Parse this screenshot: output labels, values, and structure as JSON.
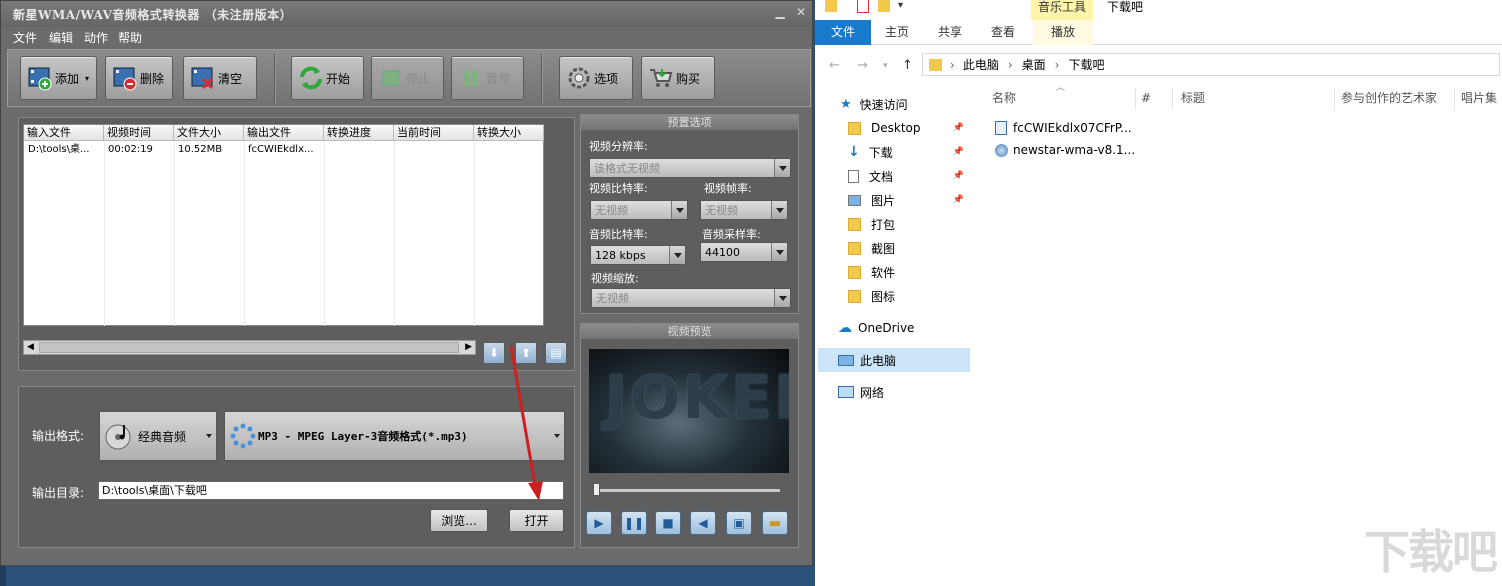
{
  "app": {
    "title": "新星WMA/WAV音频格式转换器 （未注册版本）",
    "menu": [
      "文件",
      "编辑",
      "动作",
      "帮助"
    ],
    "toolbar": {
      "add": "添加",
      "delete": "删除",
      "clear": "清空",
      "start": "开始",
      "stop": "停止",
      "pause": "暂停",
      "options": "选项",
      "buy": "购买"
    },
    "table": {
      "headers": [
        "输入文件",
        "视频时间",
        "文件大小",
        "输出文件",
        "转换进度",
        "当前时间",
        "转换大小"
      ],
      "rows": [
        [
          "D:\\tools\\桌...",
          "00:02:19",
          "10.52MB",
          "fcCWIEkdlx...",
          "",
          "",
          ""
        ]
      ]
    },
    "output": {
      "format_label": "输出格式:",
      "category": "经典音频",
      "format": "MP3 - MPEG Layer-3音频格式(*.mp3)",
      "dir_label": "输出目录:",
      "dir": "D:\\tools\\桌面\\下载吧",
      "browse": "浏览...",
      "open": "打开"
    },
    "preset": {
      "title": "预置选项",
      "resolution_label": "视频分辨率:",
      "resolution": "该格式无视频",
      "vbitrate_label": "视频比特率:",
      "vbitrate": "无视频",
      "framerate_label": "视频帧率:",
      "framerate": "无视频",
      "abitrate_label": "音频比特率:",
      "abitrate": "128 kbps",
      "samplerate_label": "音频采样率:",
      "samplerate": "44100",
      "scale_label": "视频缩放:",
      "scale": "无视频"
    },
    "preview": {
      "title": "视频预览",
      "poster_text": "JOKER"
    }
  },
  "explorer": {
    "context_tab": "音乐工具",
    "window_title": "下载吧",
    "tabs": [
      "文件",
      "主页",
      "共享",
      "查看",
      "播放"
    ],
    "path": [
      "此电脑",
      "桌面",
      "下载吧"
    ],
    "nav": [
      {
        "label": "快速访问",
        "type": "quick"
      },
      {
        "label": "Desktop",
        "type": "folder",
        "pinned": true
      },
      {
        "label": "下载",
        "type": "download",
        "pinned": true
      },
      {
        "label": "文档",
        "type": "doc",
        "pinned": true
      },
      {
        "label": "图片",
        "type": "pic",
        "pinned": true
      },
      {
        "label": "打包",
        "type": "folder"
      },
      {
        "label": "截图",
        "type": "folder"
      },
      {
        "label": "软件",
        "type": "folder"
      },
      {
        "label": "图标",
        "type": "folder"
      },
      {
        "label": "OneDrive",
        "type": "cloud"
      },
      {
        "label": "此电脑",
        "type": "pc"
      },
      {
        "label": "网络",
        "type": "net"
      }
    ],
    "columns": [
      "名称",
      "#",
      "标题",
      "参与创作的艺术家",
      "唱片集"
    ],
    "files": [
      "fcCWIEkdlx07CFrP...",
      "newstar-wma-v8.1..."
    ]
  },
  "watermark": "下载吧",
  "colors": {
    "accent": "#0078d7",
    "context": "#fff4a8",
    "arrow": "#cc1f1f"
  }
}
